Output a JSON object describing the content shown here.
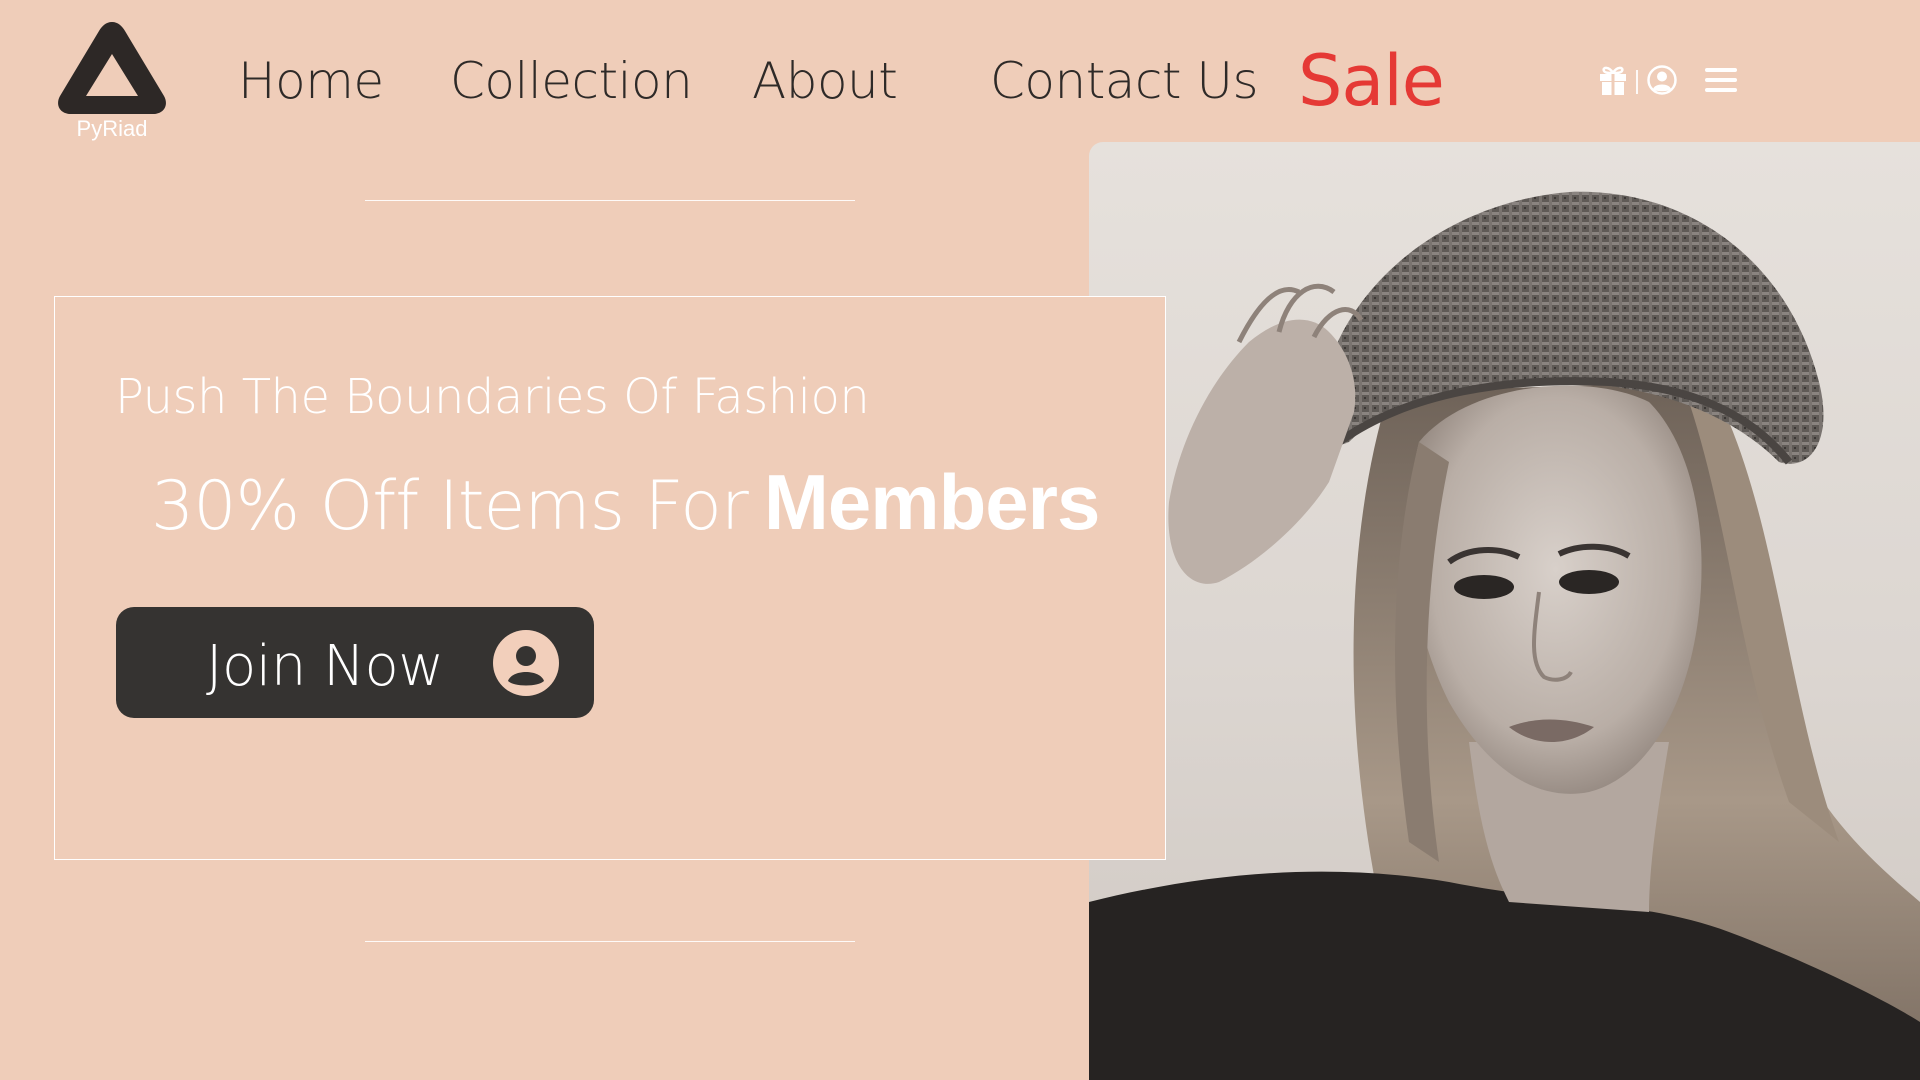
{
  "brand": {
    "name": "PyRiad",
    "logo_icon": "triangle-logo-icon"
  },
  "nav": {
    "items": [
      {
        "label": "Home"
      },
      {
        "label": "Collection"
      },
      {
        "label": "About"
      },
      {
        "label": "Contact Us"
      }
    ],
    "sale_label": "Sale",
    "sale_color": "#e53935"
  },
  "header_icons": [
    {
      "icon": "gift-icon"
    },
    {
      "icon": "user-account-icon"
    },
    {
      "icon": "hamburger-menu-icon"
    }
  ],
  "promo": {
    "subtitle": "Push The Boundaries Of Fashion",
    "headline_lead": "30% Off Items For",
    "headline_strong": "Members",
    "cta_label": "Join Now",
    "cta_icon": "user-circle-icon"
  },
  "colors": {
    "background": "#efcdb9",
    "text_dark": "#2e2a28",
    "button_bg": "#353331",
    "accent_sale": "#e53935"
  }
}
